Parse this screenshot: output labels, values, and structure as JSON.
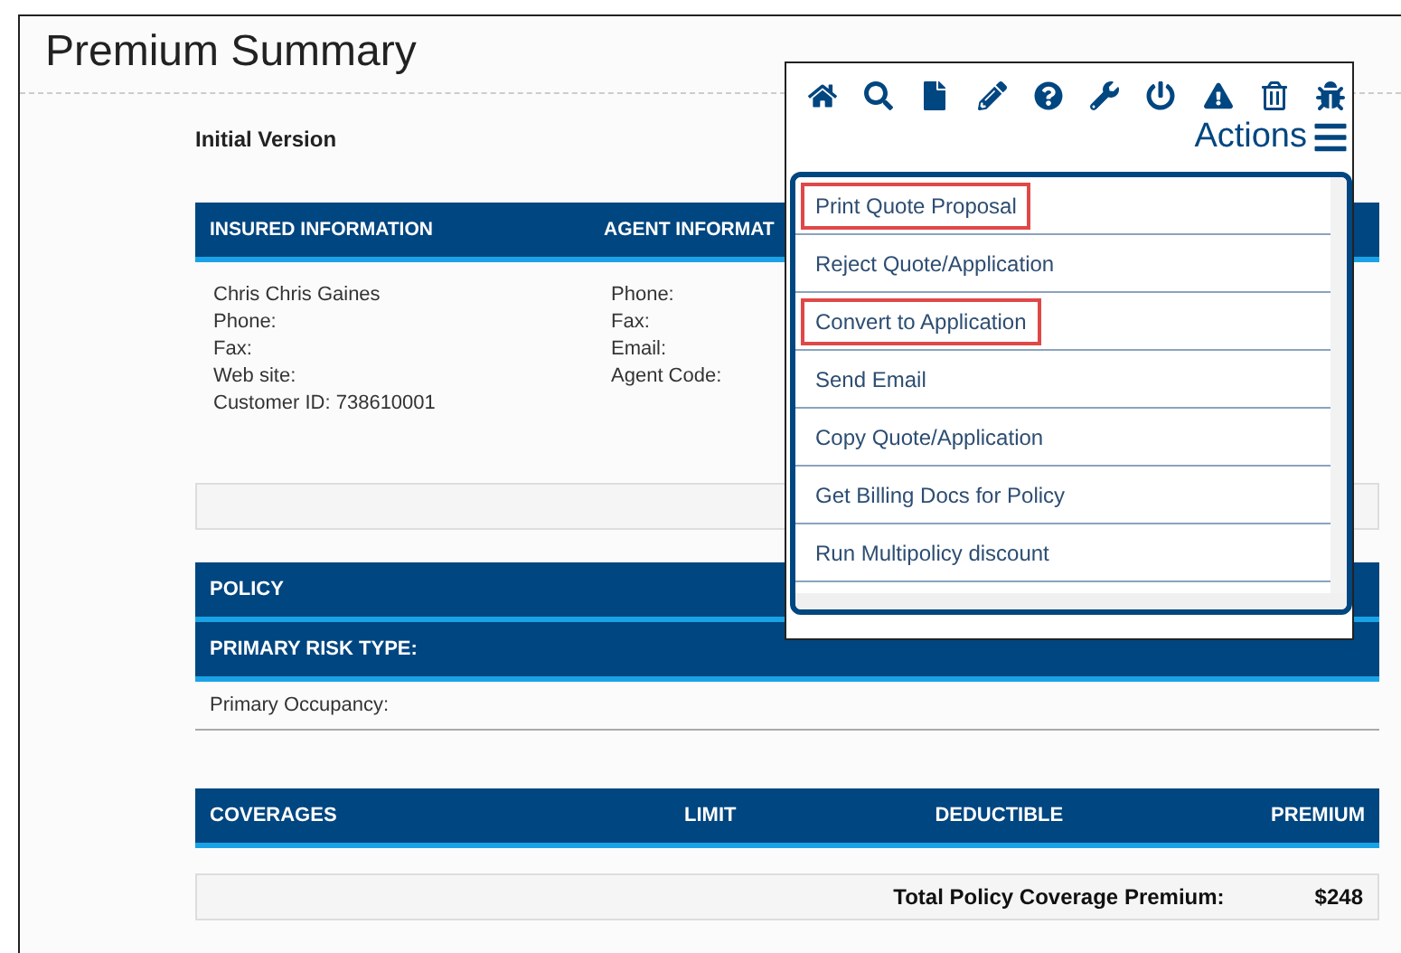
{
  "page": {
    "title": "Premium Summary",
    "version": "Initial Version"
  },
  "info_table": {
    "columns": [
      "INSURED INFORMATION",
      "AGENT INFORMAT"
    ],
    "insured": [
      "Chris Chris Gaines",
      "Phone:",
      "Fax:",
      "Web site:",
      "Customer ID: 738610001"
    ],
    "agent": [
      "Phone:",
      "Fax:",
      "Email:",
      "Agent Code:"
    ]
  },
  "policy": {
    "header": "POLICY",
    "risk_header": "PRIMARY RISK TYPE:",
    "occupancy": "Primary Occupancy:"
  },
  "coverages": {
    "columns": [
      "COVERAGES",
      "LIMIT",
      "DEDUCTIBLE",
      "PREMIUM"
    ],
    "total_label": "Total Policy Coverage Premium:",
    "total_value": "$248"
  },
  "actions_menu": {
    "title": "Actions",
    "items": [
      {
        "label": "Print Quote Proposal",
        "highlighted": true
      },
      {
        "label": "Reject Quote/Application",
        "highlighted": false
      },
      {
        "label": "Convert to Application",
        "highlighted": true
      },
      {
        "label": "Send Email",
        "highlighted": false
      },
      {
        "label": "Copy Quote/Application",
        "highlighted": false
      },
      {
        "label": "Get Billing Docs for Policy",
        "highlighted": false
      },
      {
        "label": "Run Multipolicy discount",
        "highlighted": false
      }
    ]
  }
}
